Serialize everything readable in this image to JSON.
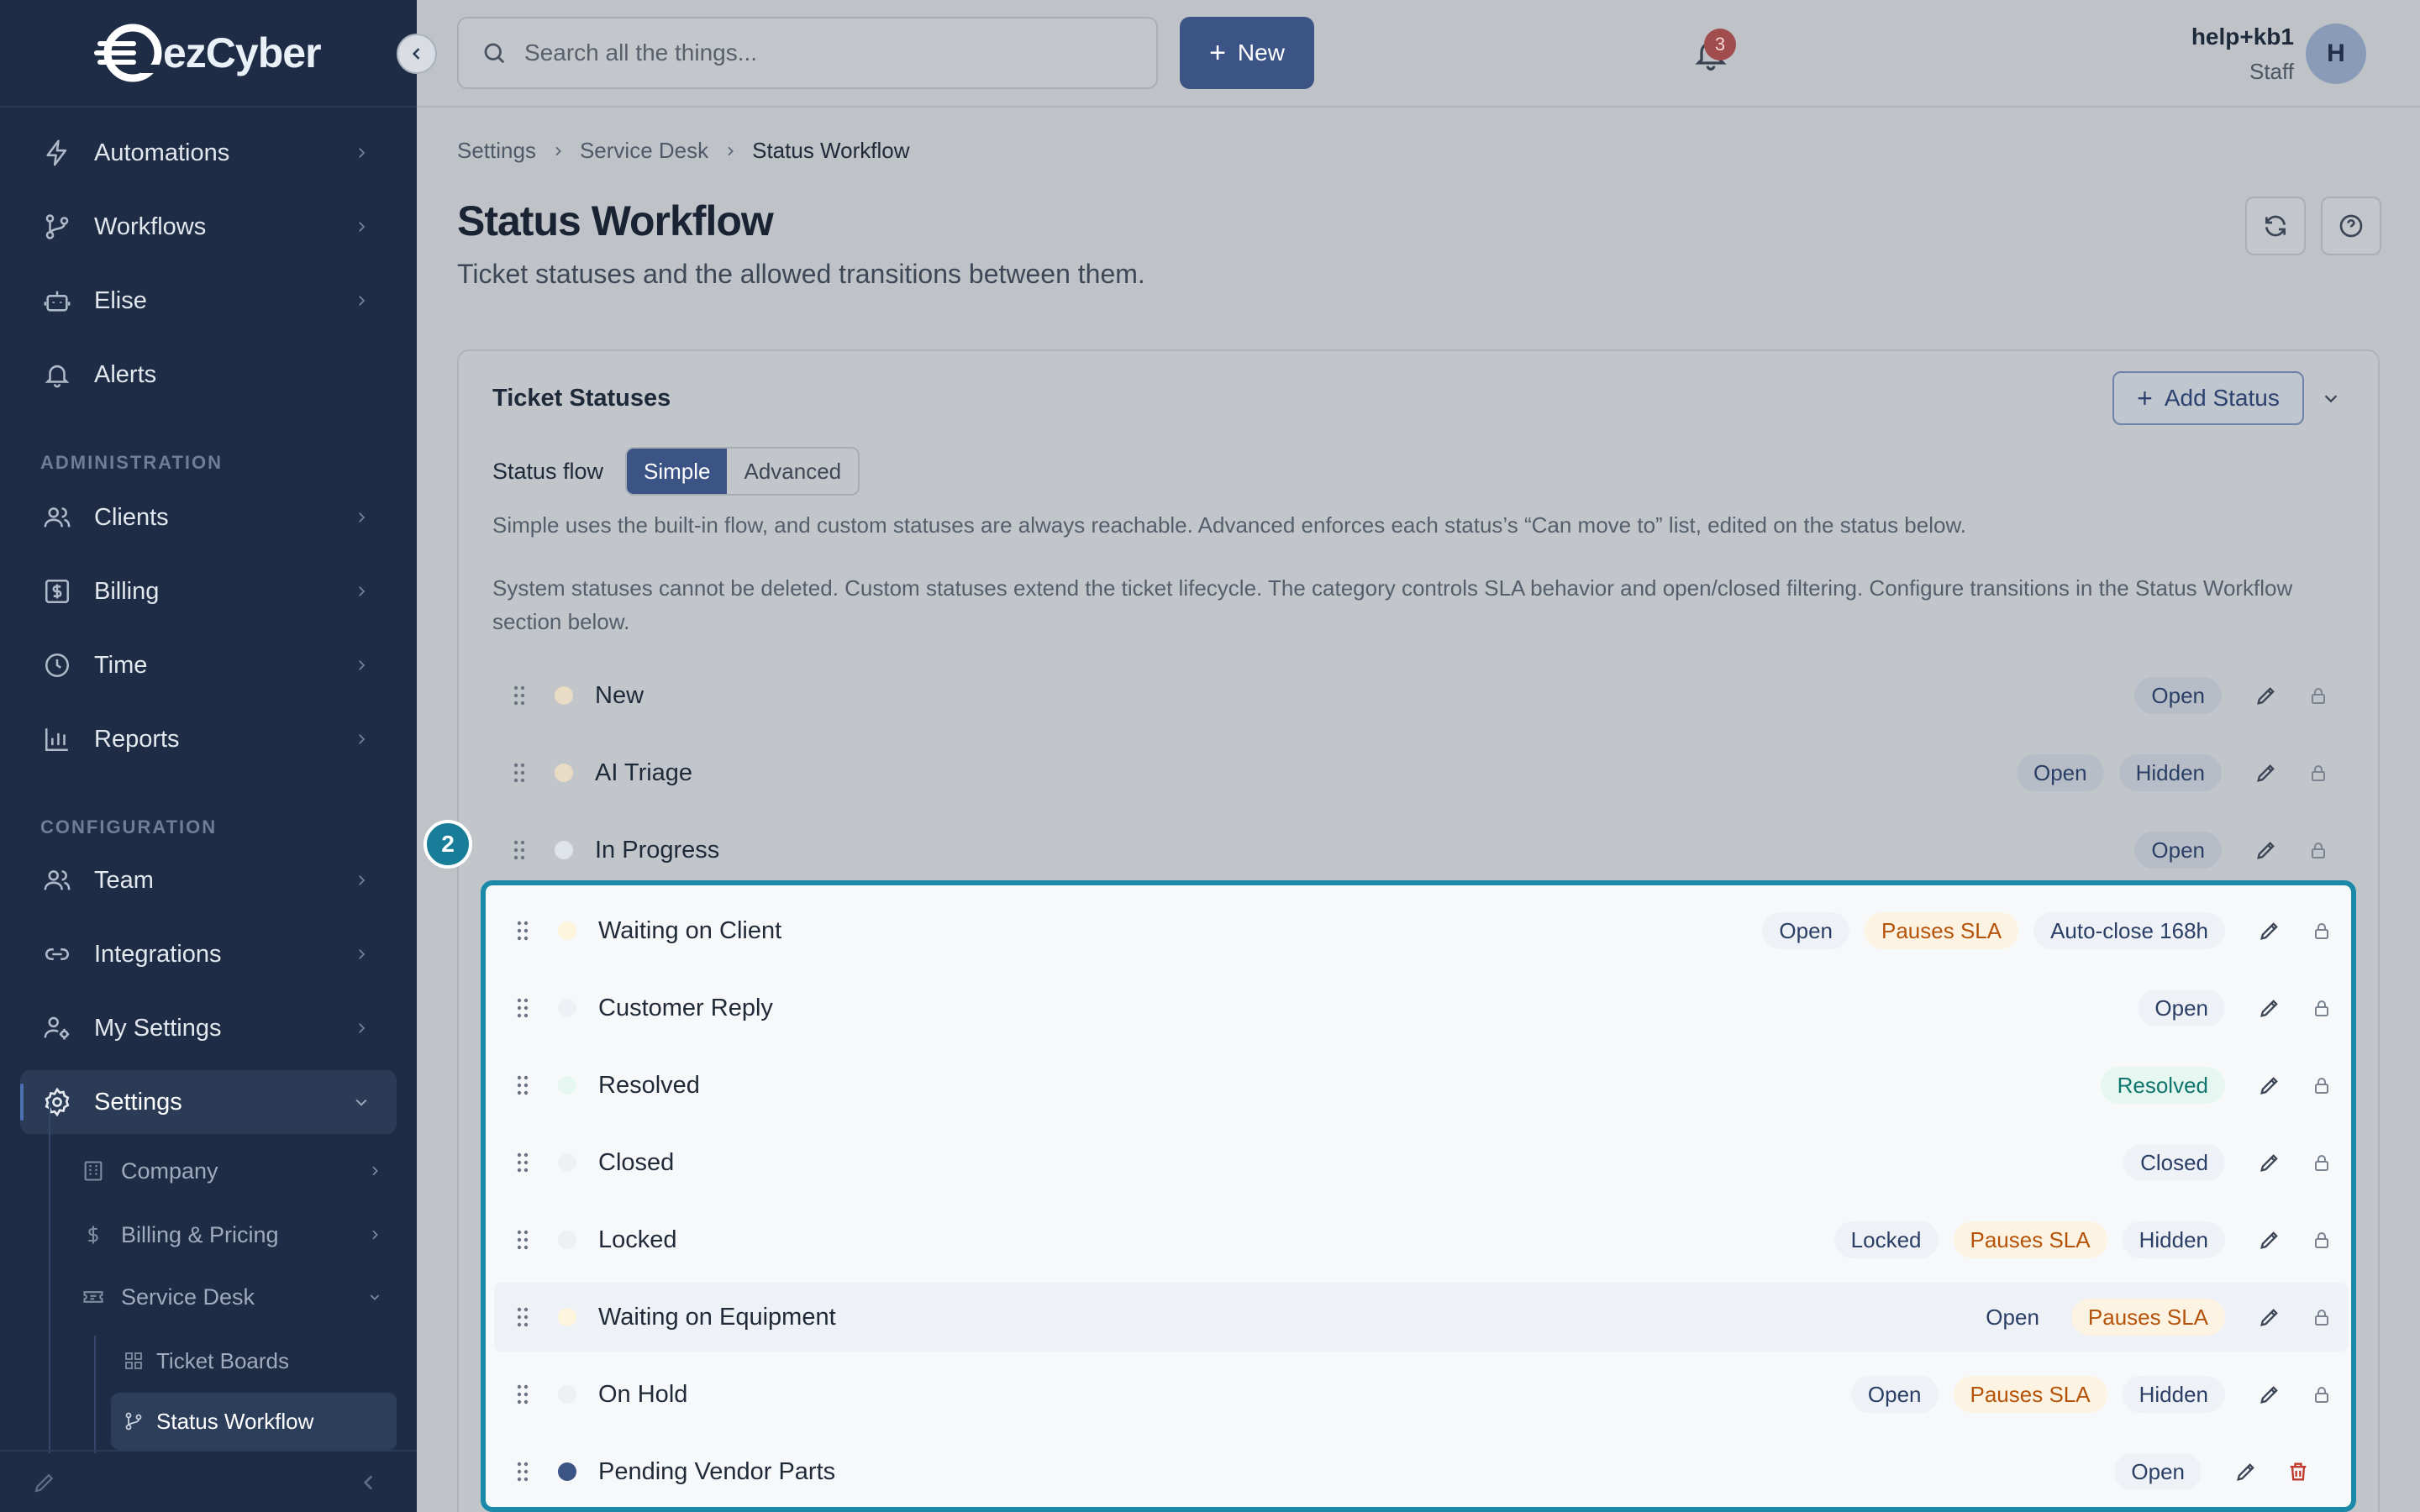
{
  "brand": {
    "name": "ezCyber"
  },
  "sidebar": {
    "items": [
      {
        "label": "Automations",
        "icon": "bolt-icon"
      },
      {
        "label": "Workflows",
        "icon": "branch-icon"
      },
      {
        "label": "Elise",
        "icon": "robot-icon"
      },
      {
        "label": "Alerts",
        "icon": "bell-icon"
      }
    ],
    "admin_label": "ADMINISTRATION",
    "admin_items": [
      {
        "label": "Clients",
        "icon": "users-icon"
      },
      {
        "label": "Billing",
        "icon": "dollar-icon"
      },
      {
        "label": "Time",
        "icon": "clock-icon"
      },
      {
        "label": "Reports",
        "icon": "bar-chart-icon"
      }
    ],
    "config_label": "CONFIGURATION",
    "config_items": [
      {
        "label": "Team",
        "icon": "users-icon"
      },
      {
        "label": "Integrations",
        "icon": "link-icon"
      },
      {
        "label": "My Settings",
        "icon": "user-cog-icon"
      },
      {
        "label": "Settings",
        "icon": "gear-icon",
        "active": true
      }
    ],
    "settings_sub": [
      {
        "label": "Company",
        "icon": "building-icon"
      },
      {
        "label": "Billing & Pricing",
        "icon": "dollar-icon"
      },
      {
        "label": "Service Desk",
        "icon": "ticket-icon"
      }
    ],
    "service_desk_sub": [
      {
        "label": "Ticket Boards",
        "icon": "grid-icon"
      },
      {
        "label": "Status Workflow",
        "icon": "branch-icon",
        "active": true
      }
    ]
  },
  "topbar": {
    "search_placeholder": "Search all the things...",
    "new_label": "New",
    "notification_count": "3",
    "user_name": "help+kb1",
    "user_role": "Staff",
    "avatar_initial": "H"
  },
  "breadcrumb": [
    "Settings",
    "Service Desk",
    "Status Workflow"
  ],
  "page": {
    "title": "Status Workflow",
    "subtitle": "Ticket statuses and the allowed transitions between them."
  },
  "card": {
    "title": "Ticket Statuses",
    "add_label": "Add Status",
    "flow_label": "Status flow",
    "flow_options": [
      "Simple",
      "Advanced"
    ],
    "flow_selected": "Simple",
    "desc1": "Simple uses the built-in flow, and custom statuses are always reachable. Advanced enforces each status’s “Can move to” list, edited on the status below.",
    "desc2": "System statuses cannot be deleted. Custom statuses extend the ticket lifecycle. The category controls SLA behavior and open/closed filtering. Configure transitions in the Status Workflow section below."
  },
  "statuses": [
    {
      "name": "New",
      "dot": "#e9dcc4",
      "badges": [
        {
          "text": "Open",
          "kind": "plain"
        }
      ],
      "action": "lock"
    },
    {
      "name": "AI Triage",
      "dot": "#e9dcc4",
      "badges": [
        {
          "text": "Open",
          "kind": "plain"
        },
        {
          "text": "Hidden",
          "kind": "plain"
        }
      ],
      "action": "lock"
    },
    {
      "name": "In Progress",
      "dot": "#dfe3ea",
      "badges": [
        {
          "text": "Open",
          "kind": "plain"
        }
      ],
      "action": "lock"
    },
    {
      "name": "Waiting on Client",
      "dot": "#fdf6dc",
      "badges": [
        {
          "text": "Open",
          "kind": "plain"
        },
        {
          "text": "Pauses SLA",
          "kind": "sla"
        },
        {
          "text": "Auto-close 168h",
          "kind": "plain"
        }
      ],
      "action": "lock"
    },
    {
      "name": "Customer Reply",
      "dot": "#eef0f6",
      "badges": [
        {
          "text": "Open",
          "kind": "plain"
        }
      ],
      "action": "lock"
    },
    {
      "name": "Resolved",
      "dot": "#e6f7f1",
      "badges": [
        {
          "text": "Resolved",
          "kind": "res"
        }
      ],
      "action": "lock"
    },
    {
      "name": "Closed",
      "dot": "#eef0f4",
      "badges": [
        {
          "text": "Closed",
          "kind": "plain"
        }
      ],
      "action": "lock"
    },
    {
      "name": "Locked",
      "dot": "#eef0f4",
      "badges": [
        {
          "text": "Locked",
          "kind": "plain"
        },
        {
          "text": "Pauses SLA",
          "kind": "sla"
        },
        {
          "text": "Hidden",
          "kind": "plain"
        }
      ],
      "action": "lock"
    },
    {
      "name": "Waiting on Equipment",
      "dot": "#fdf6dc",
      "badges": [
        {
          "text": "Open",
          "kind": "plain"
        },
        {
          "text": "Pauses SLA",
          "kind": "sla"
        }
      ],
      "action": "lock",
      "highlight": true
    },
    {
      "name": "On Hold",
      "dot": "#eef0f4",
      "badges": [
        {
          "text": "Open",
          "kind": "plain"
        },
        {
          "text": "Pauses SLA",
          "kind": "sla"
        },
        {
          "text": "Hidden",
          "kind": "plain"
        }
      ],
      "action": "lock"
    },
    {
      "name": "Pending Vendor Parts",
      "dot": "#3c5485",
      "badges": [
        {
          "text": "Open",
          "kind": "plain"
        }
      ],
      "action": "delete"
    }
  ],
  "step_marker": "2"
}
